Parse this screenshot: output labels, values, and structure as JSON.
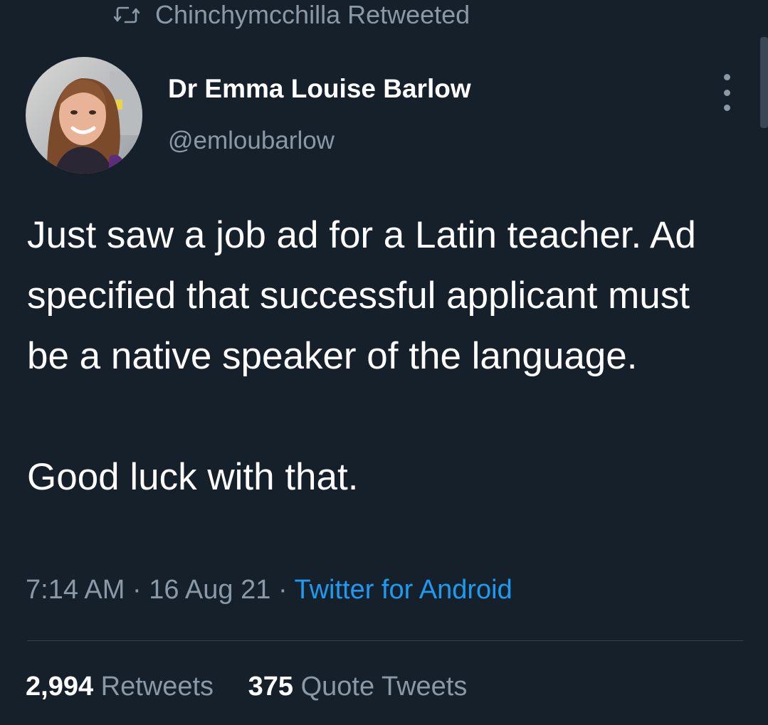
{
  "retweet_header": {
    "icon": "retweet-icon",
    "text": "Chinchymcchilla Retweeted"
  },
  "author": {
    "display_name": "Dr Emma Louise Barlow",
    "handle": "@emloubarlow",
    "avatar": "profile-photo"
  },
  "tweet": {
    "paragraph_1": "Just saw a job ad for a Latin teacher. Ad specified that successful applicant must be a native speaker of the language.",
    "paragraph_2": "Good luck with that."
  },
  "meta": {
    "time": "7:14 AM",
    "separator": "·",
    "date": "16 Aug 21",
    "source": "Twitter for Android"
  },
  "stats": {
    "retweets_count": "2,994",
    "retweets_label": "Retweets",
    "quote_tweets_count": "375",
    "quote_tweets_label": "Quote Tweets"
  },
  "colors": {
    "background": "#15202b",
    "primary_text": "#ffffff",
    "secondary_text": "#8b98a5",
    "link": "#1d9bf0",
    "divider": "#38444d"
  },
  "icons": {
    "more": "more-vertical-icon"
  }
}
